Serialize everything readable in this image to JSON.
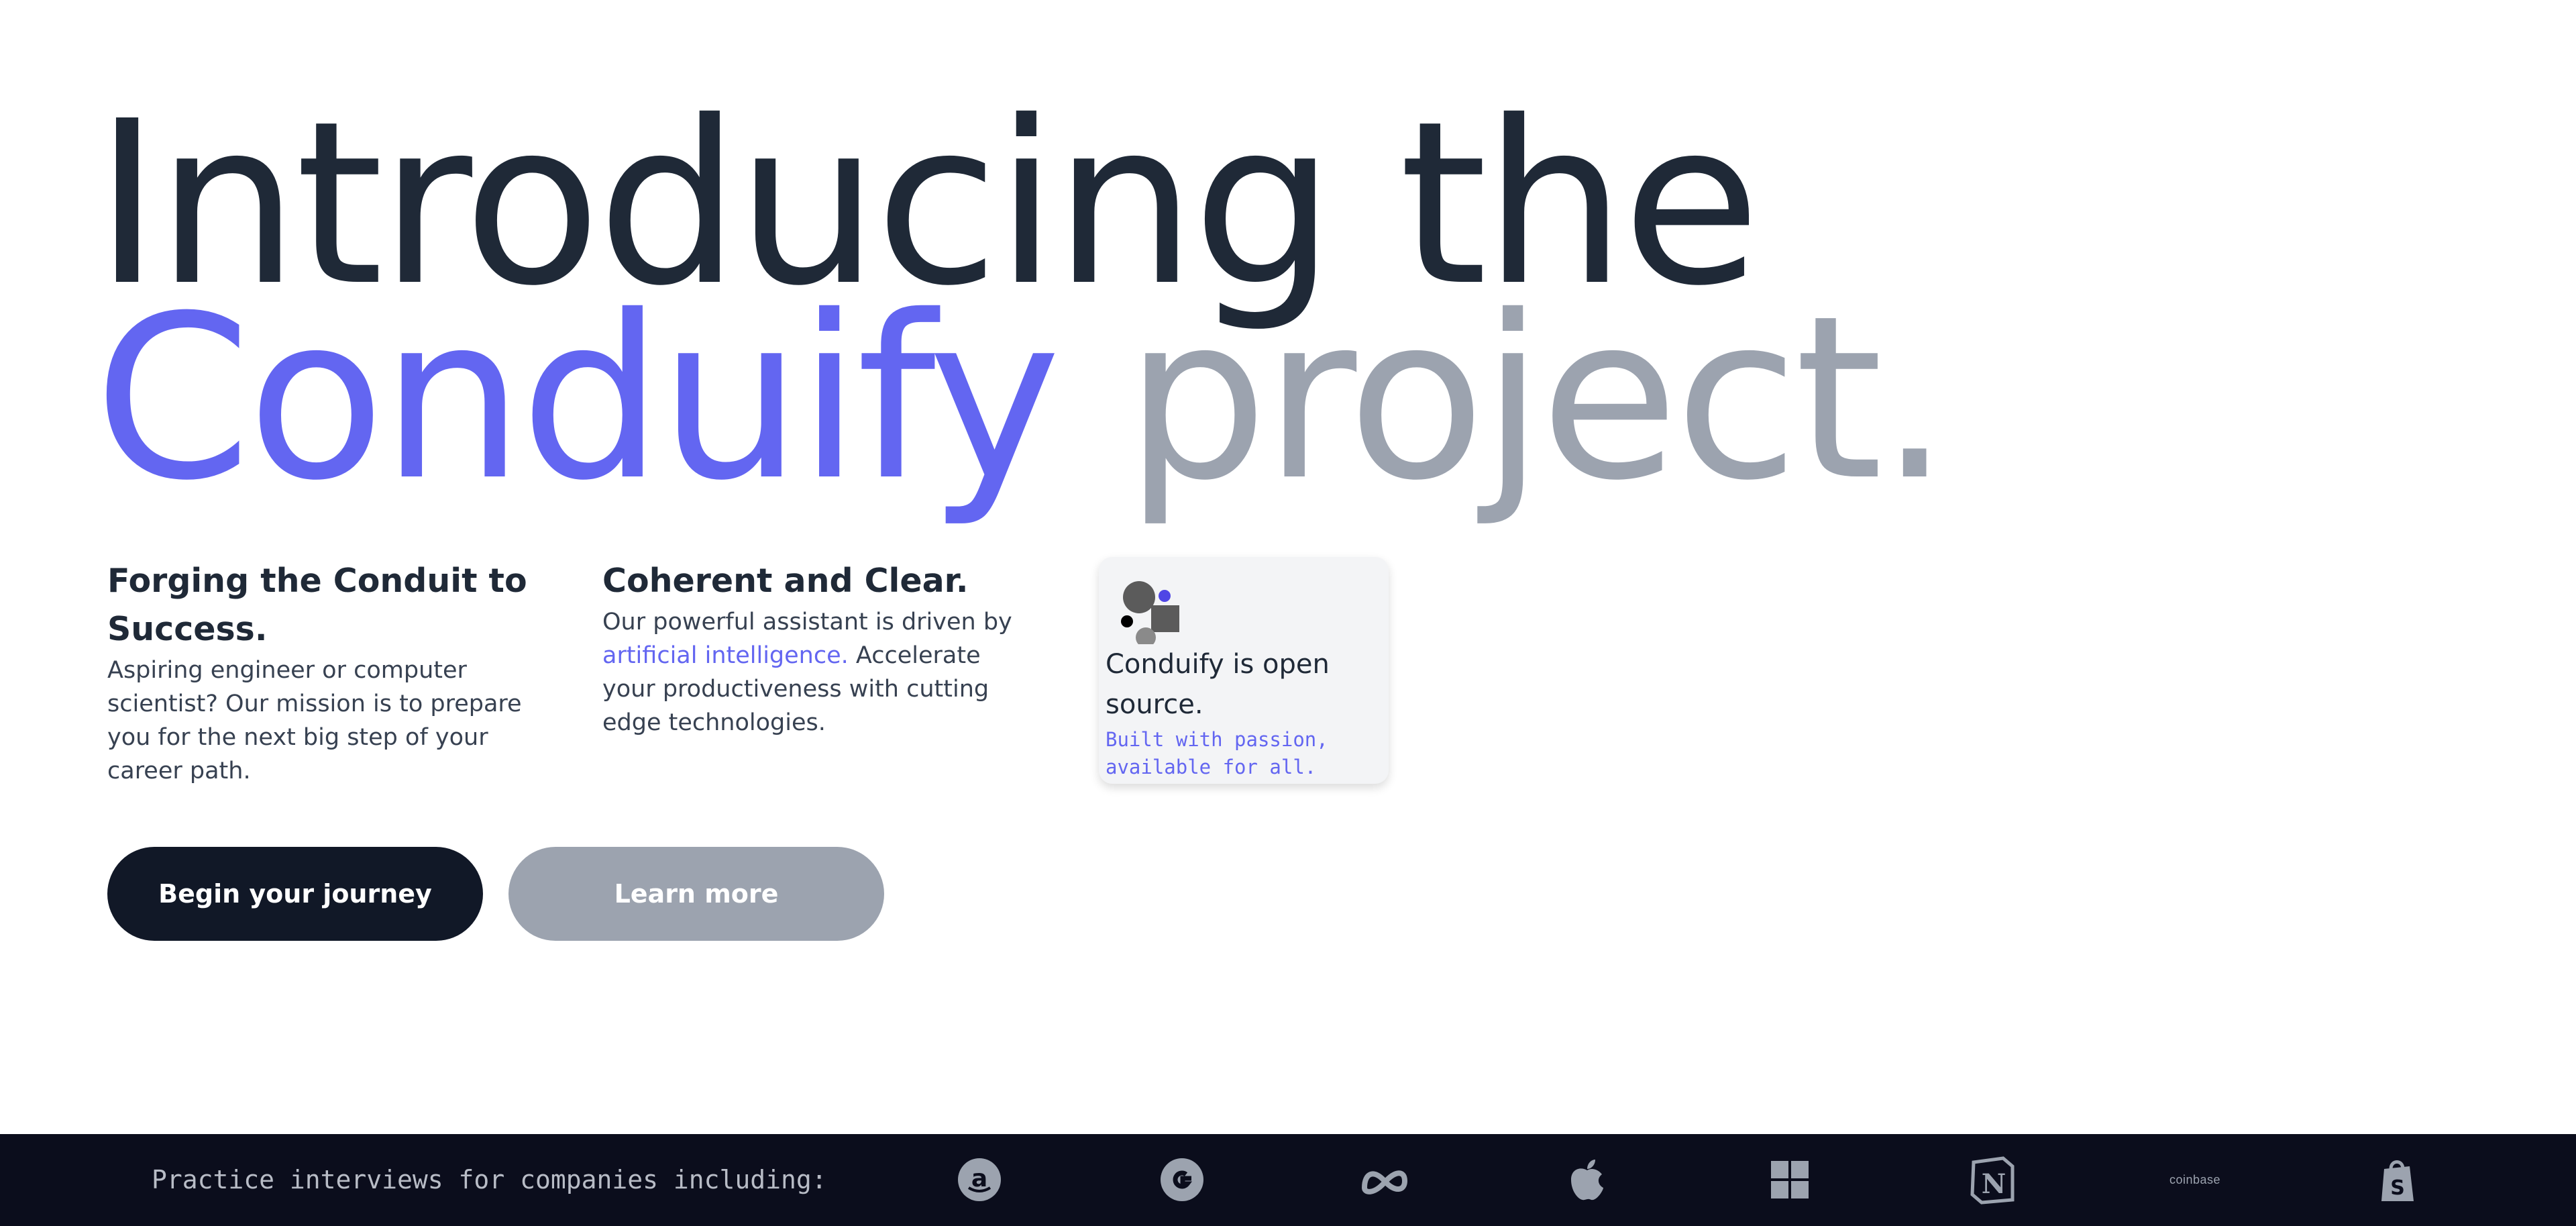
{
  "hero": {
    "line1": "Introducing the",
    "brand": "Conduify",
    "tail": "project."
  },
  "features": [
    {
      "title": "Forging the Conduit to Success.",
      "body": "Aspiring engineer or computer scientist? Our mission is to prepare you for the next big step of your career path."
    },
    {
      "title": "Coherent and Clear.",
      "body_before": "Our powerful assistant is driven by",
      "link": "artificial intelligence.",
      "body_after": "Accelerate your productiveness with cutting edge technologies."
    }
  ],
  "open_source_card": {
    "title": "Conduify is open source.",
    "subtitle": "Built with passion, available for all."
  },
  "buttons": {
    "primary": "Begin your journey",
    "secondary": "Learn more"
  },
  "footer": {
    "text": "Practice interviews for companies including:",
    "companies": [
      {
        "name": "Amazon",
        "icon": "amazon-icon"
      },
      {
        "name": "Google",
        "icon": "google-icon"
      },
      {
        "name": "Meta",
        "icon": "meta-icon"
      },
      {
        "name": "Apple",
        "icon": "apple-icon"
      },
      {
        "name": "Microsoft",
        "icon": "microsoft-icon"
      },
      {
        "name": "Notion",
        "icon": "notion-icon"
      },
      {
        "name": "coinbase",
        "icon": "coinbase-icon"
      },
      {
        "name": "Shopify",
        "icon": "shopify-icon"
      }
    ]
  },
  "colors": {
    "brand": "#6366f1",
    "dark": "#1f2937",
    "muted": "#9ca3af",
    "footer_bg": "#0b0d1c"
  }
}
